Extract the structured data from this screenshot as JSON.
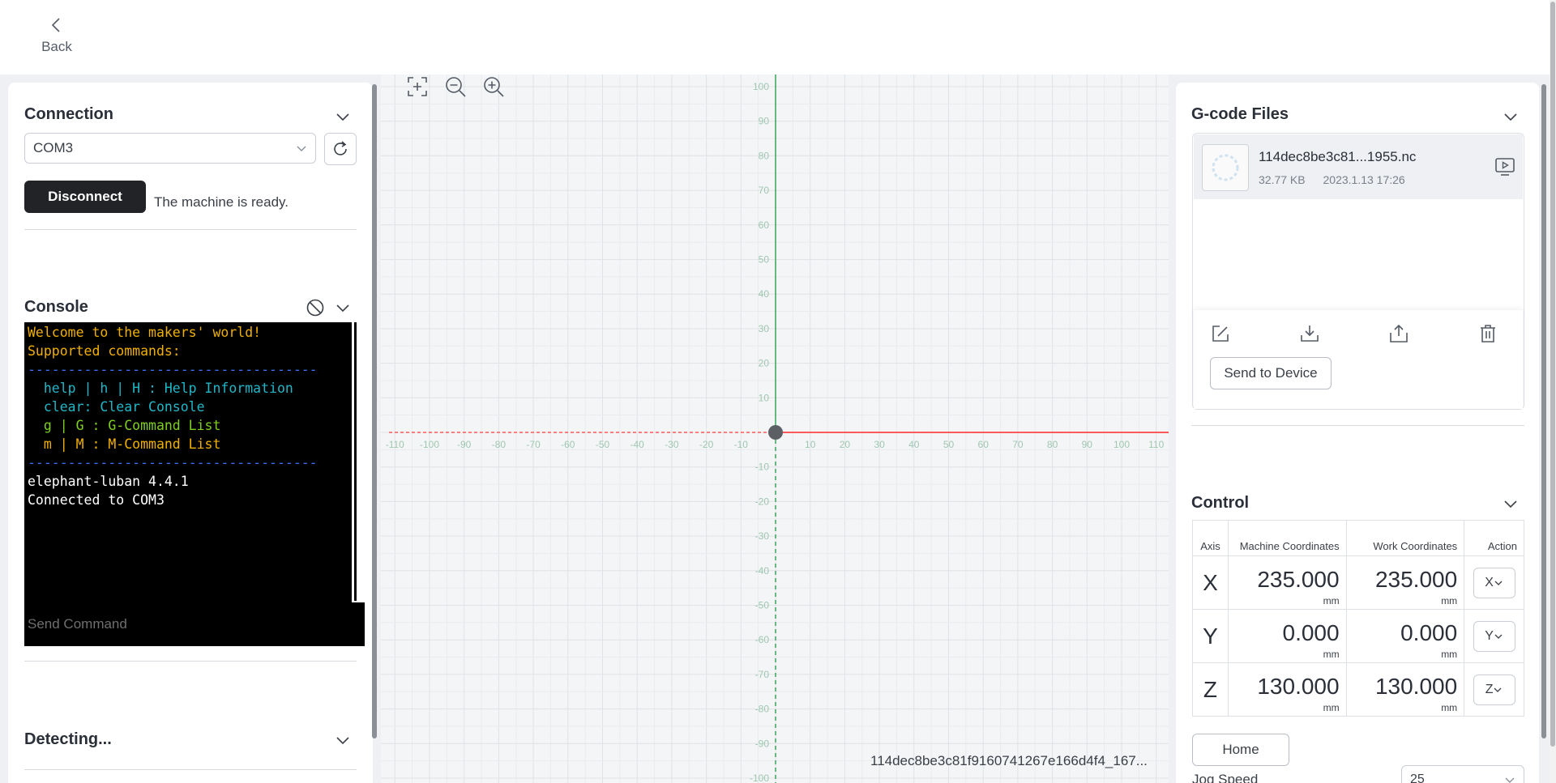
{
  "nav": {
    "back_label": "Back"
  },
  "connection": {
    "title": "Connection",
    "port_value": "COM3",
    "disconnect_label": "Disconnect",
    "status": "The machine is ready."
  },
  "console": {
    "title": "Console",
    "lines": [
      {
        "text": "Welcome to the makers' world!",
        "color": "#f0b000"
      },
      {
        "text": "Supported commands:",
        "color": "#f0b000"
      },
      {
        "text": "------------------------------------",
        "color": "#3b6ff5"
      },
      {
        "text": "  help | h | H : Help Information",
        "color": "#21b6c8"
      },
      {
        "text": "  clear: Clear Console",
        "color": "#21b6c8"
      },
      {
        "text": "  g | G : G-Command List",
        "color": "#7fcf21"
      },
      {
        "text": "  m | M : M-Command List",
        "color": "#f0b000"
      },
      {
        "text": "------------------------------------",
        "color": "#3b6ff5"
      },
      {
        "text": "elephant-luban 4.4.1",
        "color": "#ffffff"
      },
      {
        "text": "Connected to COM3",
        "color": "#ffffff"
      }
    ],
    "input_placeholder": "Send Command"
  },
  "detecting": {
    "title": "Detecting..."
  },
  "canvas": {
    "file_label": "114dec8be3c81f9160741267e166d4f4_167...",
    "x_ticks": [
      "-110",
      "-100",
      "-90",
      "-80",
      "-70",
      "-60",
      "-50",
      "-40",
      "-30",
      "-20",
      "-10",
      "10",
      "20",
      "30",
      "40",
      "50",
      "60",
      "70",
      "80",
      "90",
      "100",
      "110"
    ],
    "y_ticks": [
      "100",
      "90",
      "80",
      "70",
      "60",
      "50",
      "40",
      "30",
      "20",
      "10",
      "-10",
      "-20",
      "-30",
      "-40",
      "-50",
      "-60",
      "-70",
      "-80",
      "-90",
      "-100"
    ]
  },
  "gcode": {
    "title": "G-code Files",
    "file": {
      "name": "114dec8be3c81...1955.nc",
      "size": "32.77 KB",
      "date": "2023.1.13 17:26"
    },
    "send_label": "Send to Device"
  },
  "control": {
    "title": "Control",
    "headers": {
      "axis": "Axis",
      "machine": "Machine Coordinates",
      "work": "Work Coordinates",
      "action": "Action"
    },
    "unit": "mm",
    "rows": [
      {
        "axis": "X",
        "machine": "235.000",
        "work": "235.000",
        "action": "X"
      },
      {
        "axis": "Y",
        "machine": "0.000",
        "work": "0.000",
        "action": "Y"
      },
      {
        "axis": "Z",
        "machine": "130.000",
        "work": "130.000",
        "action": "Z"
      }
    ],
    "home_label": "Home",
    "jog_label": "Jog Speed",
    "jog_value": "25"
  },
  "colors": {
    "accent_dark": "#222326",
    "x_axis": "#ff5a5a",
    "y_axis": "#3aa35a"
  }
}
